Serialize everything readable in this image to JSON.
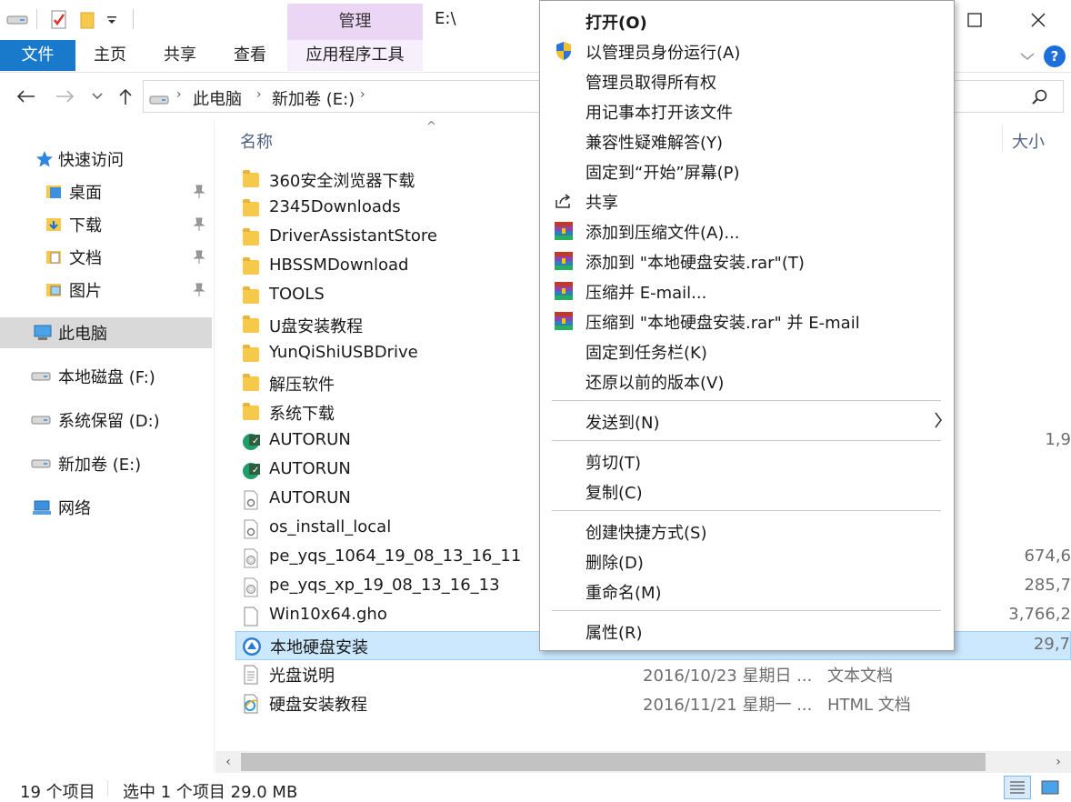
{
  "titlebar": {
    "manage_label": "管理",
    "path_title": "E:\\"
  },
  "ribbon": {
    "tabs": [
      "文件",
      "主页",
      "共享",
      "查看",
      "应用程序工具"
    ],
    "help_label": "?"
  },
  "address": {
    "crumbs": [
      "此电脑",
      "新加卷 (E:)"
    ]
  },
  "navpane": {
    "quick_access": "快速访问",
    "pinned": [
      "桌面",
      "下载",
      "文档",
      "图片"
    ],
    "this_pc": "此电脑",
    "drives": [
      "本地磁盘 (F:)",
      "系统保留 (D:)",
      "新加卷 (E:)"
    ],
    "network": "网络"
  },
  "filelist": {
    "col_name": "名称",
    "col_size": "大小",
    "sort_arrow": "^",
    "rows": [
      {
        "icon": "folder-icon",
        "name": "360安全浏览器下载",
        "date": "",
        "type": "",
        "size": ""
      },
      {
        "icon": "folder-icon",
        "name": "2345Downloads",
        "date": "",
        "type": "",
        "size": ""
      },
      {
        "icon": "folder-icon",
        "name": "DriverAssistantStore",
        "date": "",
        "type": "",
        "size": ""
      },
      {
        "icon": "folder-icon",
        "name": "HBSSMDownload",
        "date": "",
        "type": "",
        "size": ""
      },
      {
        "icon": "folder-icon",
        "name": "TOOLS",
        "date": "",
        "type": "",
        "size": ""
      },
      {
        "icon": "folder-icon",
        "name": "U盘安装教程",
        "date": "",
        "type": "",
        "size": ""
      },
      {
        "icon": "folder-icon",
        "name": "YunQiShiUSBDrive",
        "date": "",
        "type": "",
        "size": ""
      },
      {
        "icon": "folder-icon",
        "name": "解压软件",
        "date": "",
        "type": "",
        "size": ""
      },
      {
        "icon": "folder-icon",
        "name": "系统下载",
        "date": "",
        "type": "",
        "size": ""
      },
      {
        "icon": "autorun-app-icon",
        "name": "AUTORUN",
        "date": "",
        "type": "",
        "size": "1,9"
      },
      {
        "icon": "autorun-app-icon",
        "name": "AUTORUN",
        "date": "",
        "type": "",
        "size": ""
      },
      {
        "icon": "settings-file-icon",
        "name": "AUTORUN",
        "date": "",
        "type": "",
        "size": ""
      },
      {
        "icon": "settings-file-icon",
        "name": "os_install_local",
        "date": "",
        "type": "",
        "size": ""
      },
      {
        "icon": "disc-image-icon",
        "name": "pe_yqs_1064_19_08_13_16_11",
        "date": "",
        "type": "",
        "size": "674,6"
      },
      {
        "icon": "disc-image-icon",
        "name": "pe_yqs_xp_19_08_13_16_13",
        "date": "",
        "type": "",
        "size": "285,7"
      },
      {
        "icon": "blank-file-icon",
        "name": "Win10x64.gho",
        "date": "",
        "type": "",
        "size": "3,766,2"
      },
      {
        "icon": "installer-app-icon",
        "name": "本地硬盘安装",
        "date": "",
        "type": "",
        "size": "29,7"
      },
      {
        "icon": "text-file-icon",
        "name": "光盘说明",
        "date": "2016/10/23 星期日 ...",
        "type": "文本文档",
        "size": ""
      },
      {
        "icon": "html-file-icon",
        "name": "硬盘安装教程",
        "date": "2016/11/21 星期一 ...",
        "type": "HTML 文档",
        "size": ""
      }
    ]
  },
  "status": {
    "count": "19 个项目",
    "selection": "选中 1 个项目  29.0 MB"
  },
  "context_menu": {
    "items": [
      {
        "label": "打开(O)",
        "icon": "",
        "bold": true
      },
      {
        "label": "以管理员身份运行(A)",
        "icon": "uac-shield-icon"
      },
      {
        "label": "管理员取得所有权",
        "icon": ""
      },
      {
        "label": "用记事本打开该文件",
        "icon": ""
      },
      {
        "label": "兼容性疑难解答(Y)",
        "icon": ""
      },
      {
        "label": "固定到“开始”屏幕(P)",
        "icon": ""
      },
      {
        "label": "共享",
        "icon": "share-icon"
      },
      {
        "label": "添加到压缩文件(A)...",
        "icon": "winrar-icon"
      },
      {
        "label": "添加到 \"本地硬盘安装.rar\"(T)",
        "icon": "winrar-icon"
      },
      {
        "label": "压缩并 E-mail...",
        "icon": "winrar-icon"
      },
      {
        "label": "压缩到 \"本地硬盘安装.rar\" 并 E-mail",
        "icon": "winrar-icon"
      },
      {
        "label": "固定到任务栏(K)",
        "icon": ""
      },
      {
        "label": "还原以前的版本(V)",
        "icon": ""
      },
      {
        "label": "发送到(N)",
        "icon": "",
        "submenu": true
      },
      {
        "label": "剪切(T)",
        "icon": ""
      },
      {
        "label": "复制(C)",
        "icon": ""
      },
      {
        "label": "创建快捷方式(S)",
        "icon": ""
      },
      {
        "label": "删除(D)",
        "icon": ""
      },
      {
        "label": "重命名(M)",
        "icon": ""
      },
      {
        "label": "属性(R)",
        "icon": ""
      }
    ]
  },
  "colors": {
    "accent_blue": "#1979ca",
    "manage_purple": "#ecd6f6",
    "selection_blue": "#cce8ff"
  }
}
